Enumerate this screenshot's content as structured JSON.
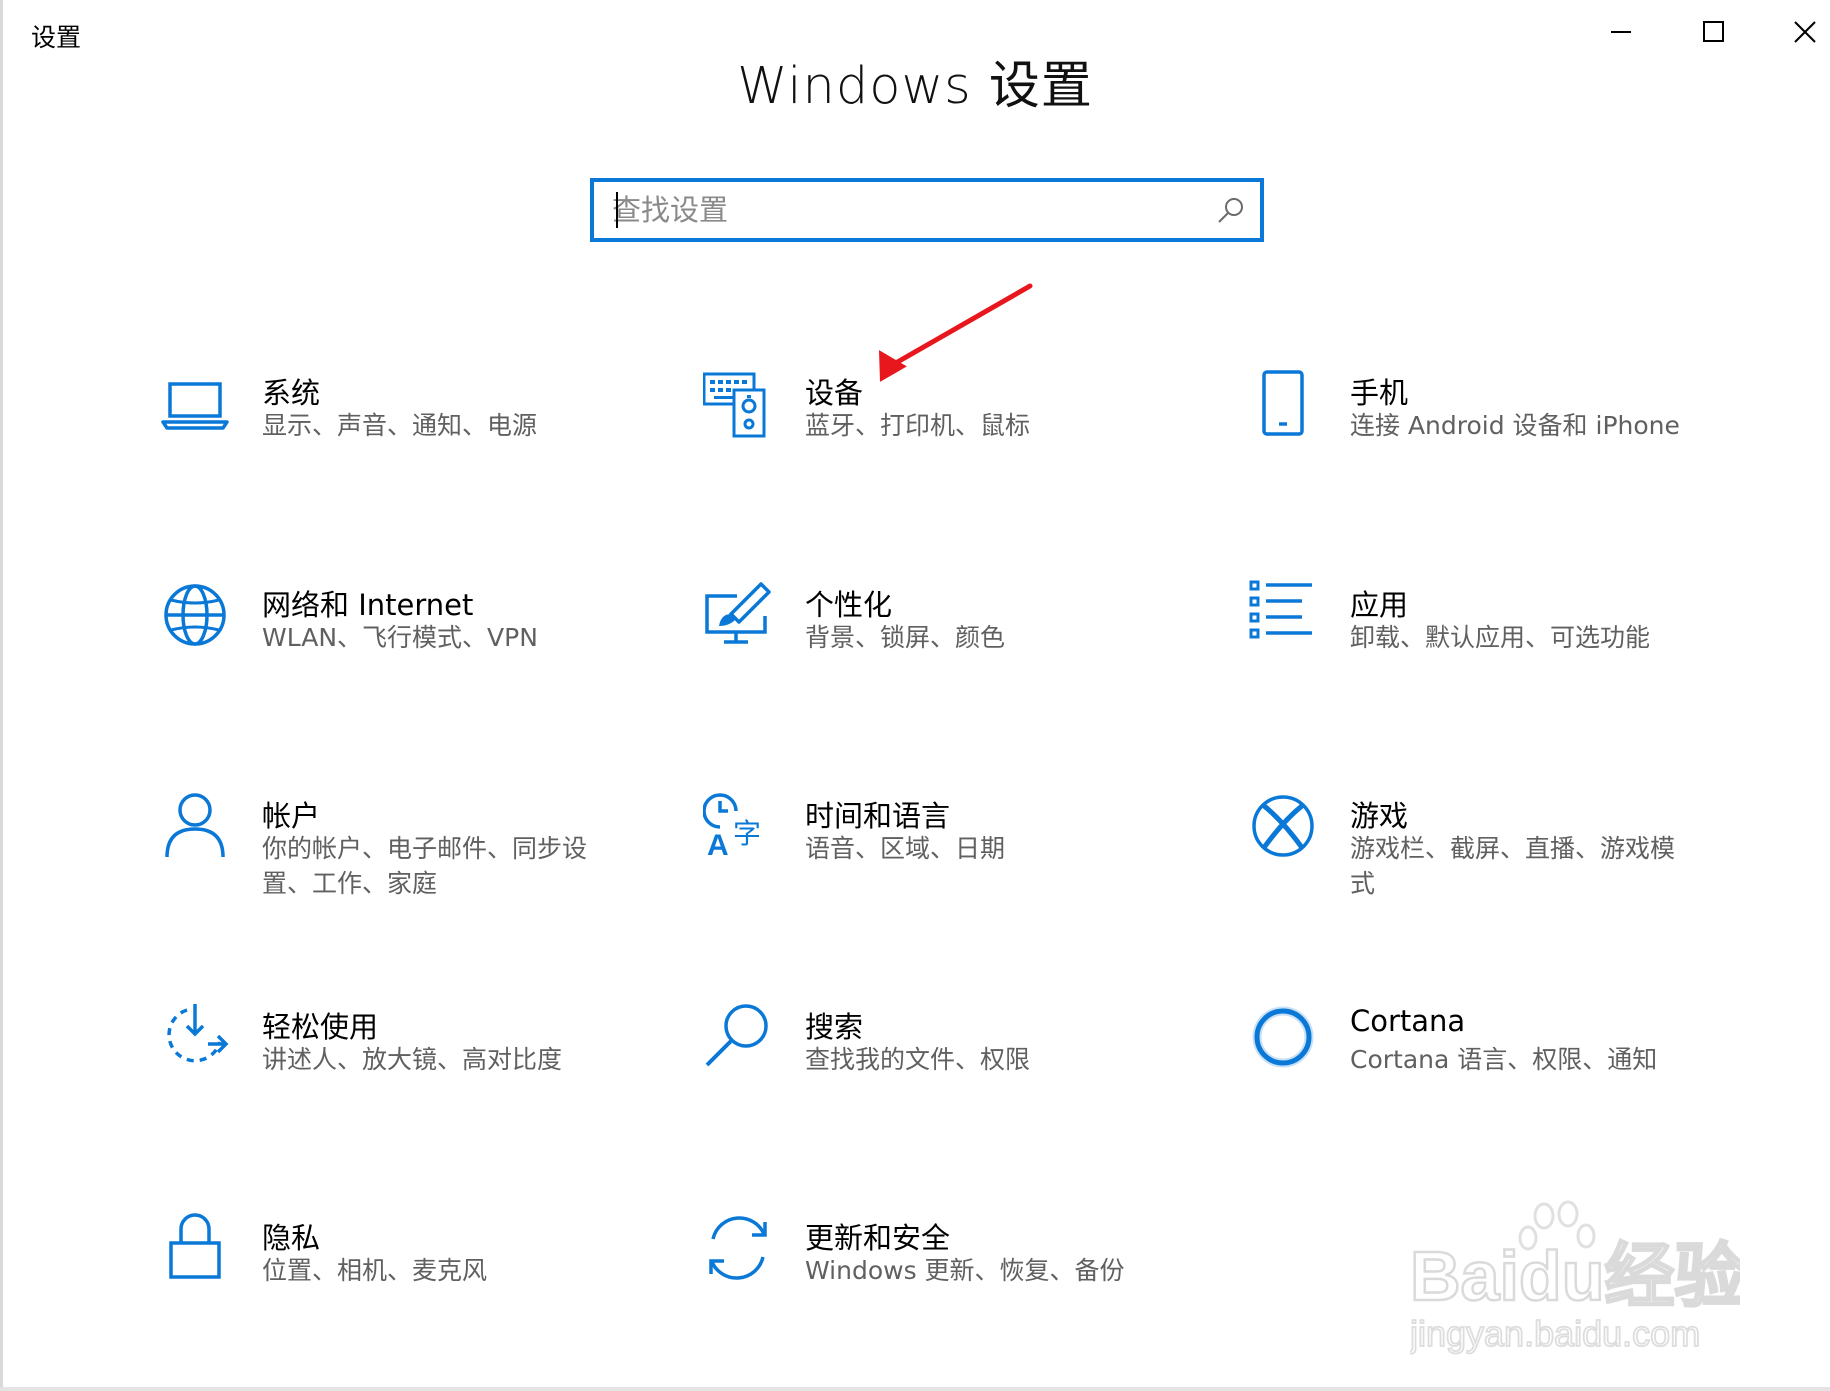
{
  "window": {
    "title": "设置"
  },
  "titlebar_buttons": {
    "minimize_icon": "minimize-icon",
    "maximize_icon": "maximize-icon",
    "close_icon": "close-icon"
  },
  "page": {
    "title": "Windows 设置"
  },
  "search": {
    "placeholder": "查找设置",
    "value": "",
    "icon": "search-icon"
  },
  "accent_color": "#0a78d7",
  "annotation_color": "#e8161d",
  "tiles": [
    {
      "title": "系统",
      "desc": "显示、声音、通知、电源",
      "icon": "laptop-icon"
    },
    {
      "title": "设备",
      "desc": "蓝牙、打印机、鼠标",
      "icon": "devices-icon"
    },
    {
      "title": "手机",
      "desc": "连接 Android 设备和 iPhone",
      "icon": "phone-icon"
    },
    {
      "title": "网络和 Internet",
      "desc": "WLAN、飞行模式、VPN",
      "icon": "globe-icon"
    },
    {
      "title": "个性化",
      "desc": "背景、锁屏、颜色",
      "icon": "personalization-icon"
    },
    {
      "title": "应用",
      "desc": "卸载、默认应用、可选功能",
      "icon": "apps-list-icon"
    },
    {
      "title": "帐户",
      "desc": "你的帐户、电子邮件、同步设置、工作、家庭",
      "icon": "person-icon"
    },
    {
      "title": "时间和语言",
      "desc": "语音、区域、日期",
      "icon": "time-language-icon"
    },
    {
      "title": "游戏",
      "desc": "游戏栏、截屏、直播、游戏模式",
      "icon": "xbox-icon"
    },
    {
      "title": "轻松使用",
      "desc": "讲述人、放大镜、高对比度",
      "icon": "ease-of-access-icon"
    },
    {
      "title": "搜索",
      "desc": "查找我的文件、权限",
      "icon": "search-magnifier-icon"
    },
    {
      "title": "Cortana",
      "desc": "Cortana 语言、权限、通知",
      "icon": "cortana-ring-icon"
    },
    {
      "title": "隐私",
      "desc": "位置、相机、麦克风",
      "icon": "lock-icon"
    },
    {
      "title": "更新和安全",
      "desc": "Windows 更新、恢复、备份",
      "icon": "sync-arrows-icon"
    }
  ],
  "watermark": {
    "brand": "Baidu经验",
    "url": "jingyan.baidu.com"
  }
}
